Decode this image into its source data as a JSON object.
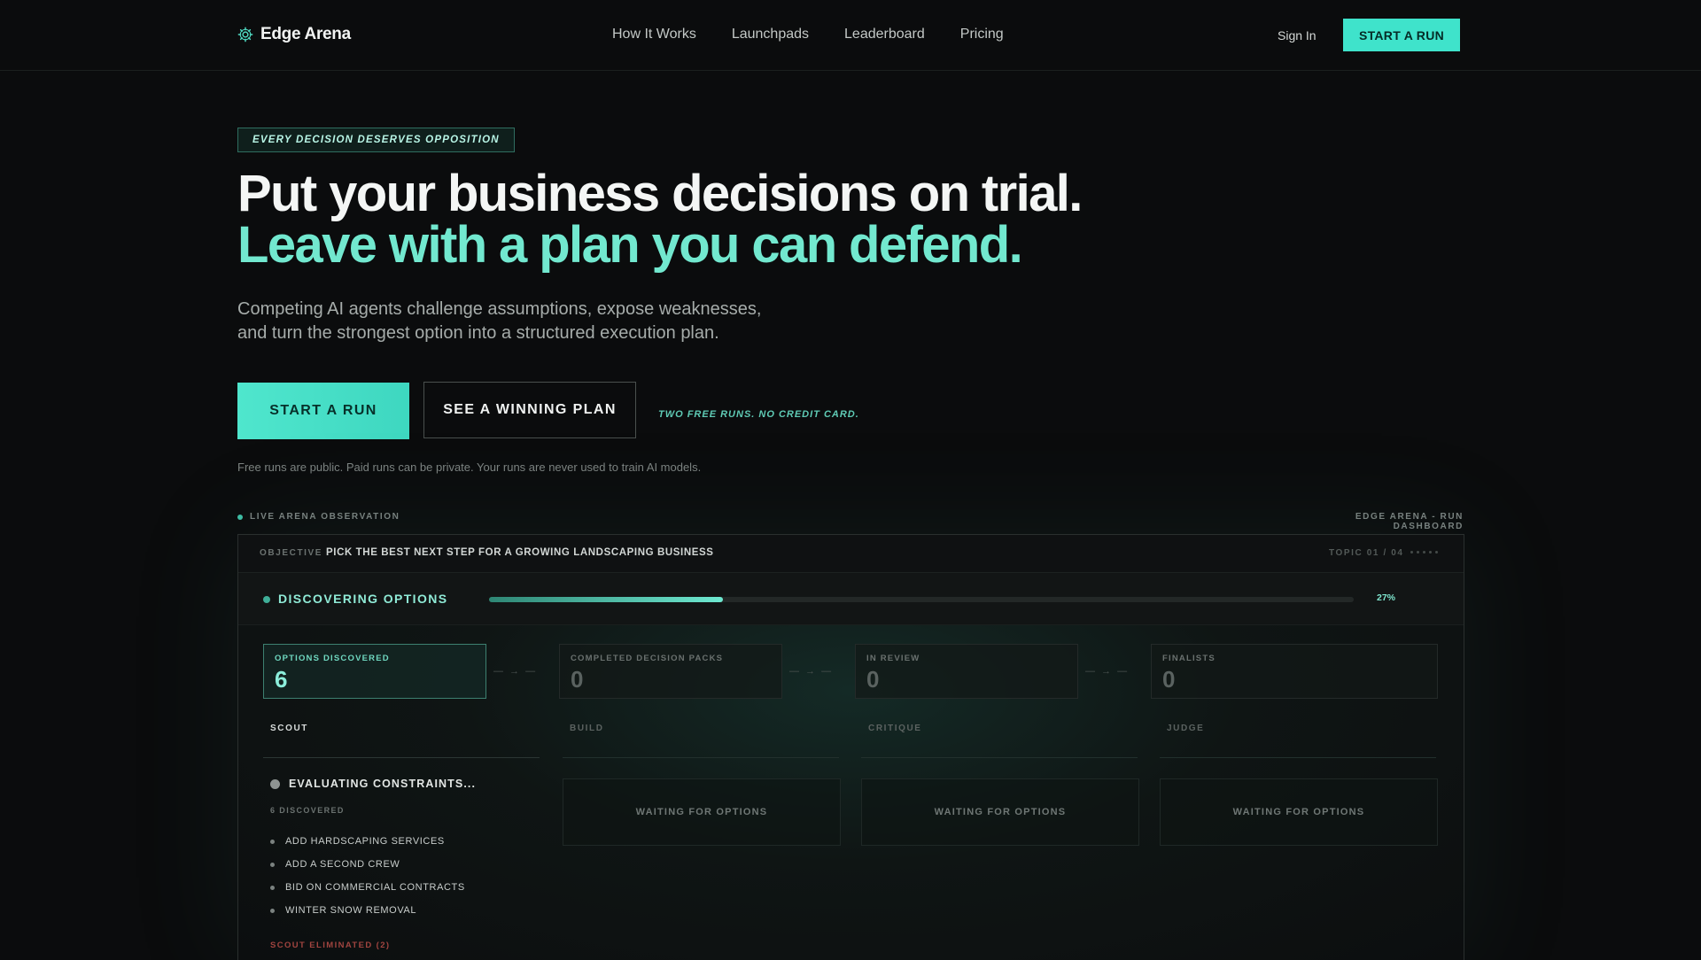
{
  "nav": {
    "brand": "Edge Arena",
    "links": [
      "How It Works",
      "Launchpads",
      "Leaderboard",
      "Pricing"
    ],
    "sign_in": "Sign In",
    "cta": "START A RUN"
  },
  "hero": {
    "tag": "EVERY DECISION DESERVES OPPOSITION",
    "headline_1": "Put your business decisions on trial.",
    "headline_2": "Leave with a plan you can defend.",
    "sub_1": "Competing AI agents challenge assumptions, expose weaknesses,",
    "sub_2": "and turn the strongest option into a structured execution plan.",
    "primary_cta": "START A RUN",
    "secondary_cta": "SEE A WINNING PLAN",
    "free_note": "TWO FREE RUNS. NO CREDIT CARD.",
    "privacy": "Free runs are public. Paid runs can be private. Your runs are never used to train AI models."
  },
  "dashboard": {
    "live_label": "LIVE ARENA OBSERVATION",
    "title": "EDGE ARENA - RUN DASHBOARD",
    "objective_label": "OBJECTIVE",
    "objective": "PICK THE BEST NEXT STEP FOR A GROWING LANDSCAPING BUSINESS",
    "topic": "TOPIC 01 / 04",
    "status": "DISCOVERING OPTIONS",
    "progress_pct_label": "27%",
    "progress_fraction": 0.27,
    "metrics": [
      {
        "label": "OPTIONS DISCOVERED",
        "value": "6"
      },
      {
        "label": "COMPLETED DECISION PACKS",
        "value": "0"
      },
      {
        "label": "IN REVIEW",
        "value": "0"
      },
      {
        "label": "FINALISTS",
        "value": "0"
      }
    ],
    "arrow": "— → —",
    "stages": [
      "SCOUT",
      "BUILD",
      "CRITIQUE",
      "JUDGE"
    ],
    "scout": {
      "status": "EVALUATING CONSTRAINTS...",
      "discovered": "6 DISCOVERED",
      "options": [
        "ADD HARDSCAPING SERVICES",
        "ADD A SECOND CREW",
        "BID ON COMMERCIAL CONTRACTS",
        "WINTER SNOW REMOVAL"
      ],
      "eliminated": "SCOUT ELIMINATED (2)"
    },
    "waiting": "WAITING FOR OPTIONS"
  },
  "colors": {
    "accent": "#3fe3cb",
    "accent_text": "#72e8cf",
    "background": "#0b0c0d",
    "danger": "#a0443f"
  }
}
